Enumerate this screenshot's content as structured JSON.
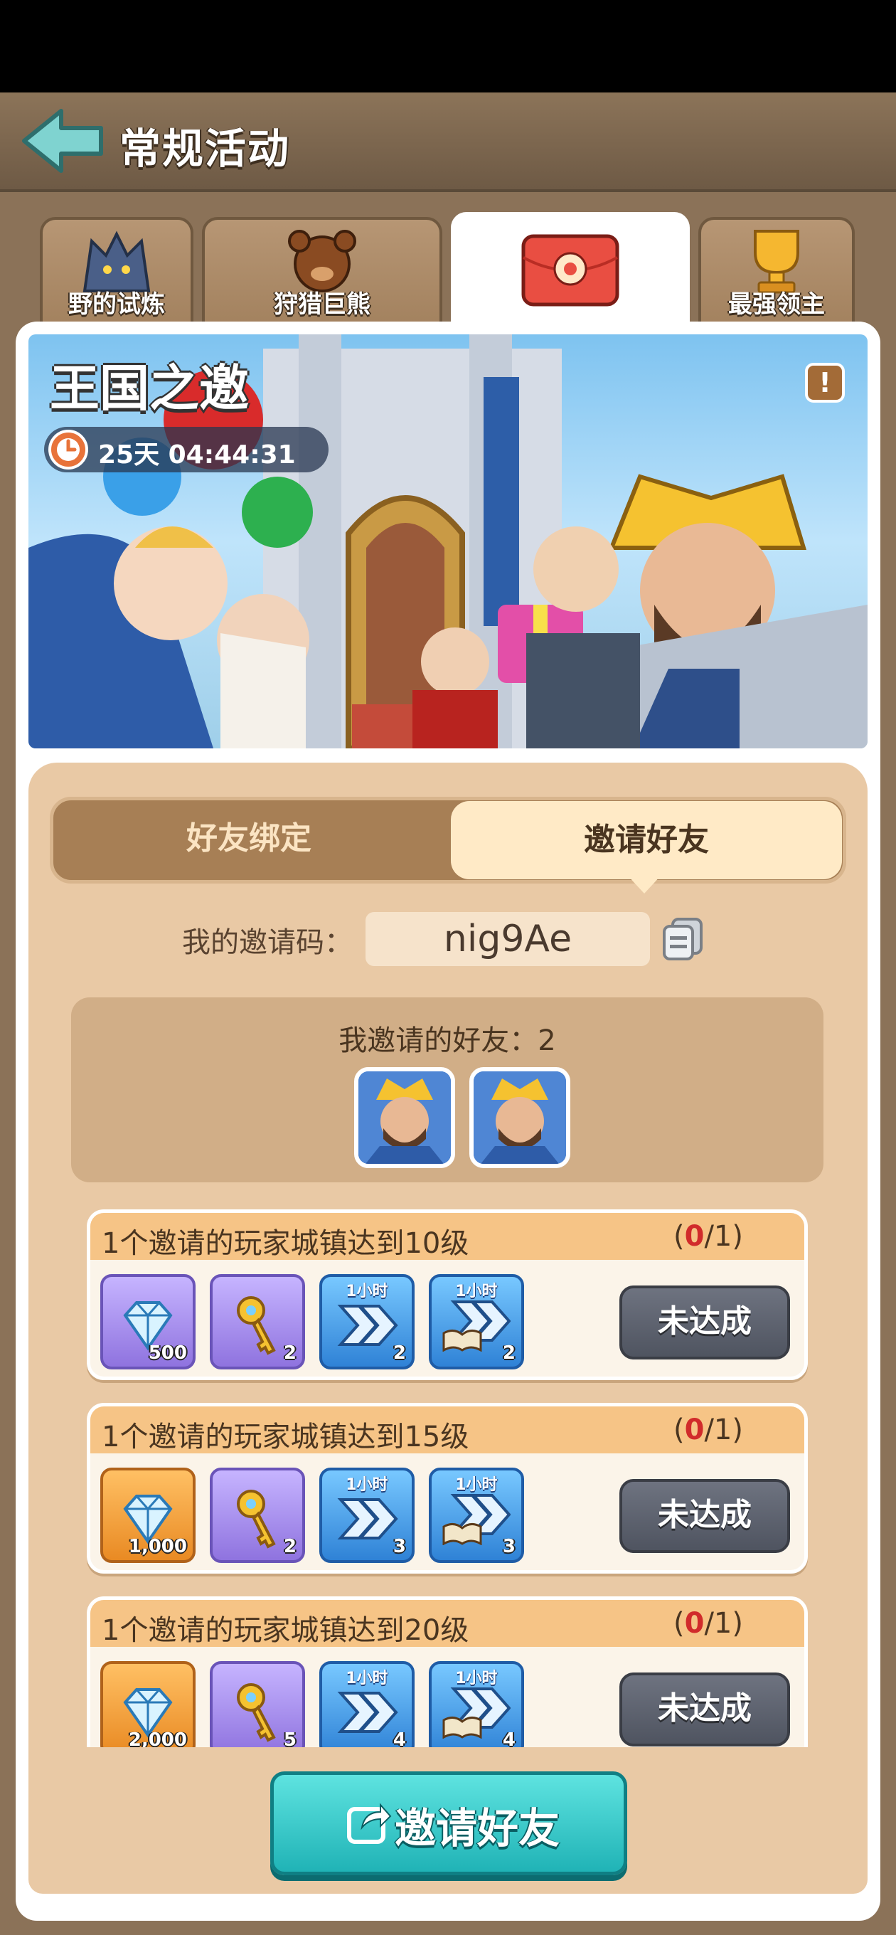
{
  "header": {
    "title": "常规活动"
  },
  "tabs": [
    {
      "label": "野的试炼",
      "icon": "wolf-icon",
      "active": false
    },
    {
      "label": "狩猎巨熊",
      "icon": "bear-icon",
      "active": false
    },
    {
      "label": "",
      "icon": "red-envelope-icon",
      "active": true
    },
    {
      "label": "最强领主",
      "icon": "trophy-icon",
      "active": false
    }
  ],
  "banner": {
    "title": "王国之邀",
    "timer": "25天 04:44:31"
  },
  "segment": {
    "left": "好友绑定",
    "right": "邀请好友",
    "selected": "邀请好友"
  },
  "invite_code": {
    "label": "我的邀请码：",
    "value": "nig9Ae"
  },
  "friends": {
    "label": "我邀请的好友：2",
    "count": 2
  },
  "tasks": [
    {
      "title": "1个邀请的玩家城镇达到10级",
      "progress_current": "0",
      "progress_total": "1",
      "rewards": [
        {
          "type": "diamond-icon",
          "qty": "500",
          "style": "purple",
          "top": ""
        },
        {
          "type": "key-icon",
          "qty": "2",
          "style": "purple",
          "top": ""
        },
        {
          "type": "speedup-icon",
          "qty": "2",
          "style": "blue",
          "top": "1小时"
        },
        {
          "type": "research-speedup-icon",
          "qty": "2",
          "style": "blue",
          "top": "1小时"
        }
      ],
      "status": "未达成"
    },
    {
      "title": "1个邀请的玩家城镇达到15级",
      "progress_current": "0",
      "progress_total": "1",
      "rewards": [
        {
          "type": "diamond-icon",
          "qty": "1,000",
          "style": "orange",
          "top": ""
        },
        {
          "type": "key-icon",
          "qty": "2",
          "style": "purple",
          "top": ""
        },
        {
          "type": "speedup-icon",
          "qty": "3",
          "style": "blue",
          "top": "1小时"
        },
        {
          "type": "research-speedup-icon",
          "qty": "3",
          "style": "blue",
          "top": "1小时"
        }
      ],
      "status": "未达成"
    },
    {
      "title": "1个邀请的玩家城镇达到20级",
      "progress_current": "0",
      "progress_total": "1",
      "rewards": [
        {
          "type": "diamond-icon",
          "qty": "2,000",
          "style": "orange",
          "top": ""
        },
        {
          "type": "key-icon",
          "qty": "5",
          "style": "purple",
          "top": ""
        },
        {
          "type": "speedup-icon",
          "qty": "4",
          "style": "blue",
          "top": "1小时"
        },
        {
          "type": "research-speedup-icon",
          "qty": "4",
          "style": "blue",
          "top": "1小时"
        }
      ],
      "status": "未达成"
    }
  ],
  "invite_button": {
    "label": "邀请好友"
  }
}
